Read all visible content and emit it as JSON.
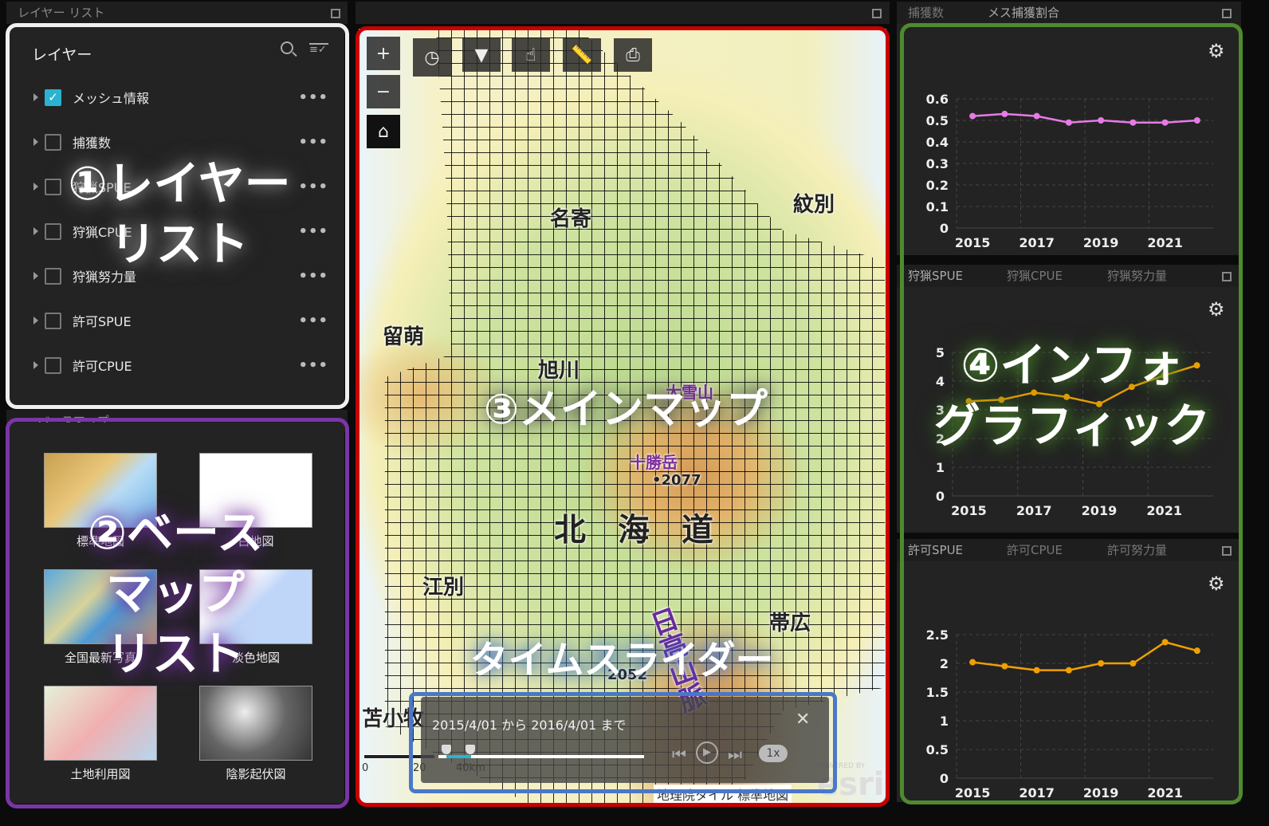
{
  "layer_panel": {
    "header": "レイヤー リスト",
    "title": "レイヤー",
    "search_icon": "search-icon",
    "filter_icon": "filter-list-icon",
    "layers": [
      {
        "label": "メッシュ情報",
        "checked": true
      },
      {
        "label": "捕獲数",
        "checked": false
      },
      {
        "label": "狩猟SPUE",
        "checked": false
      },
      {
        "label": "狩猟CPUE",
        "checked": false
      },
      {
        "label": "狩猟努力量",
        "checked": false
      },
      {
        "label": "許可SPUE",
        "checked": false
      },
      {
        "label": "許可CPUE",
        "checked": false
      }
    ],
    "more_label": "•••"
  },
  "basemap_panel": {
    "header": "ベースマップ",
    "items": [
      {
        "label": "標準地図"
      },
      {
        "label": "白地図"
      },
      {
        "label": "全国最新写真"
      },
      {
        "label": "淡色地図"
      },
      {
        "label": "土地利用図"
      },
      {
        "label": "陰影起伏図"
      }
    ]
  },
  "map": {
    "tools": [
      "+",
      "−"
    ],
    "labels": {
      "nayoro": "名寄",
      "monbetsu": "紋別",
      "rumoi": "留萌",
      "asahikawa": "旭川",
      "daisetsu": "大雪山",
      "tokachi": "十勝岳",
      "elev1": "•2077",
      "hokkaido": "北　海　道",
      "ebetsu": "江別",
      "obihiro": "帯広",
      "hidaka": "日高山脈",
      "tomakomai": "苫小牧",
      "elev2": "2052"
    },
    "attribution": "地理院タイル 標準地図",
    "esri_powered": "POWERED BY",
    "esri": "esri",
    "scale": {
      "zero": "0",
      "mid": "20",
      "end": "40km"
    }
  },
  "time_slider": {
    "range_text": "2015/4/01 から 2016/4/01 まで",
    "speed": "1x",
    "progress": 0.12
  },
  "right_panels": [
    {
      "tabs": [
        "捕獲数",
        "メス捕獲割合"
      ],
      "active": 1
    },
    {
      "tabs": [
        "狩猟SPUE",
        "狩猟CPUE",
        "狩猟努力量"
      ],
      "active": 0
    },
    {
      "tabs": [
        "許可SPUE",
        "許可CPUE",
        "許可努力量"
      ],
      "active": 0
    }
  ],
  "annotations": {
    "a1": "①レイヤー\nリスト",
    "a2": "②ベース\nマップ\nリスト",
    "a3": "③メインマップ",
    "a_ts": "タイムスライダー",
    "a4": "④インフォ\nグラフィック"
  },
  "chart_data": [
    {
      "type": "line",
      "x": [
        2015,
        2016,
        2017,
        2018,
        2019,
        2020,
        2021,
        2022
      ],
      "values": [
        0.52,
        0.53,
        0.52,
        0.49,
        0.5,
        0.49,
        0.49,
        0.5
      ],
      "ylim": [
        0,
        0.6
      ],
      "yticks": [
        "0",
        "0.1",
        "0.2",
        "0.3",
        "0.4",
        "0.5",
        "0.6"
      ],
      "xticks": [
        "2015",
        "2017",
        "2019",
        "2021"
      ],
      "color": "#e67be6",
      "grid": true
    },
    {
      "type": "line",
      "x": [
        2015,
        2016,
        2017,
        2018,
        2019,
        2020,
        2021,
        2022
      ],
      "values": [
        3.3,
        3.35,
        3.6,
        3.45,
        3.2,
        3.8,
        4.2,
        4.55
      ],
      "ylim": [
        0,
        5
      ],
      "yticks": [
        "0",
        "1",
        "2",
        "3",
        "4",
        "5"
      ],
      "xticks": [
        "2015",
        "2017",
        "2019",
        "2021"
      ],
      "color": "#f0a000",
      "grid": true
    },
    {
      "type": "line",
      "x": [
        2015,
        2016,
        2017,
        2018,
        2019,
        2020,
        2021,
        2022
      ],
      "values": [
        2.02,
        1.95,
        1.88,
        1.88,
        2.0,
        2.0,
        2.37,
        2.22
      ],
      "ylim": [
        0,
        2.5
      ],
      "yticks": [
        "0",
        "0.5",
        "1",
        "1.5",
        "2",
        "2.5"
      ],
      "xticks": [
        "2015",
        "2017",
        "2019",
        "2021"
      ],
      "color": "#f0a000",
      "grid": true
    }
  ]
}
